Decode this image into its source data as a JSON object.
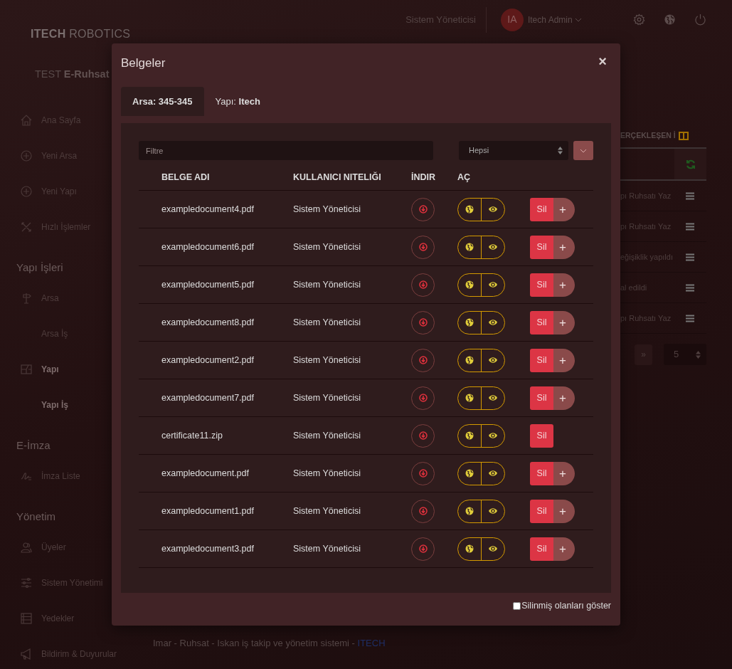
{
  "header": {
    "role": "Sistem Yöneticisi",
    "avatar_initials": "IA",
    "user_name": "Itech Admin"
  },
  "brand": {
    "strong": "ITECH",
    "light": "ROBOTICS"
  },
  "app_title": {
    "prefix": "TEST",
    "name": "E-Ruhsat"
  },
  "sidebar": {
    "groups": [
      {
        "items": [
          {
            "label": "Ana Sayfa",
            "selected": false
          },
          {
            "label": "Yeni Arsa",
            "selected": false
          },
          {
            "label": "Yeni Yapı",
            "selected": false
          },
          {
            "label": "Hızlı İşlemler",
            "selected": false
          }
        ]
      },
      {
        "title": "Yapı İşleri",
        "items": [
          {
            "label": "Arsa",
            "selected": false
          },
          {
            "label": "Arsa İş",
            "selected": false
          },
          {
            "label": "Yapı",
            "selected": true
          },
          {
            "label": "Yapı İş",
            "selected": true
          }
        ]
      },
      {
        "title": "E-İmza",
        "items": [
          {
            "label": "İmza Liste",
            "selected": false
          }
        ]
      },
      {
        "title": "Yönetim",
        "items": [
          {
            "label": "Üyeler",
            "selected": false
          },
          {
            "label": "Sistem Yönetimi",
            "selected": false
          },
          {
            "label": "Yedekler",
            "selected": false
          },
          {
            "label": "Bildirim & Duyurular",
            "selected": false
          }
        ]
      }
    ]
  },
  "background_table": {
    "column_1": "ERÇEKLEŞEN İ",
    "rows": [
      "pı Ruhsatı Yaz",
      "pı Ruhsatı Yaz",
      "eğişiklik yapıldı",
      "al edildi",
      "pı Ruhsatı Yaz"
    ],
    "pagination": {
      "last": "»",
      "page_size": "5"
    }
  },
  "footer": {
    "text": "Imar - Ruhsat - Iskan iş takip ve yönetim sistemi - ",
    "link": "ITECH"
  },
  "modal": {
    "title": "Belgeler",
    "close": "×",
    "tabs": [
      {
        "prefix": "Arsa:",
        "value": "345-345",
        "selected": true
      },
      {
        "prefix": "Yapı:",
        "value": "Itech",
        "selected": false
      }
    ],
    "filter": {
      "placeholder": "Filtre"
    },
    "type_select": {
      "value": "Hepsi"
    },
    "columns": [
      "BELGE ADI",
      "KULLANICI NITELIĞI",
      "İNDIR",
      "AÇ"
    ],
    "rows": [
      {
        "name": "exampledocument4.pdf",
        "role": "Sistem Yöneticisi",
        "delete": "Sil",
        "add": "+"
      },
      {
        "name": "exampledocument6.pdf",
        "role": "Sistem Yöneticisi",
        "delete": "Sil",
        "add": "+"
      },
      {
        "name": "exampledocument5.pdf",
        "role": "Sistem Yöneticisi",
        "delete": "Sil",
        "add": "+"
      },
      {
        "name": "exampledocument8.pdf",
        "role": "Sistem Yöneticisi",
        "delete": "Sil",
        "add": "+"
      },
      {
        "name": "exampledocument2.pdf",
        "role": "Sistem Yöneticisi",
        "delete": "Sil",
        "add": "+"
      },
      {
        "name": "exampledocument7.pdf",
        "role": "Sistem Yöneticisi",
        "delete": "Sil",
        "add": "+"
      },
      {
        "name": "certificate11.zip",
        "role": "Sistem Yöneticisi",
        "delete": "Sil"
      },
      {
        "name": "exampledocument.pdf",
        "role": "Sistem Yöneticisi",
        "delete": "Sil",
        "add": "+"
      },
      {
        "name": "exampledocument1.pdf",
        "role": "Sistem Yöneticisi",
        "delete": "Sil",
        "add": "+"
      },
      {
        "name": "exampledocument3.pdf",
        "role": "Sistem Yöneticisi",
        "delete": "Sil",
        "add": "+"
      }
    ],
    "show_deleted": {
      "label": "Silinmiş olanları göster",
      "checked": false
    }
  }
}
